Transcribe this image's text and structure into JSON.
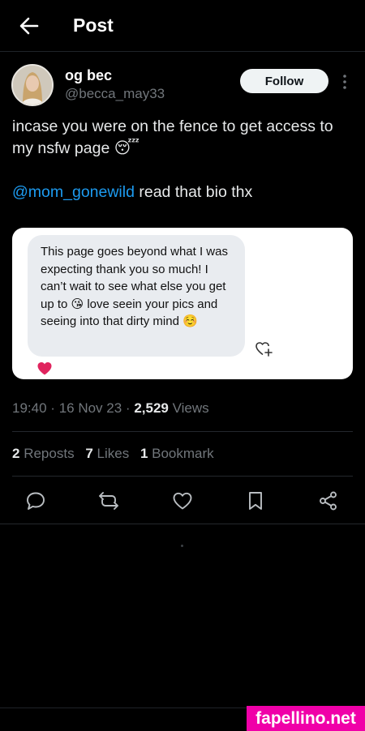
{
  "header": {
    "title": "Post"
  },
  "author": {
    "display_name": "og bec",
    "handle": "@becca_may33",
    "follow_label": "Follow"
  },
  "tweet": {
    "line1": "incase you were on the fence to get access to my nsfw page 😴",
    "mention": "@mom_gonewild",
    "line2_rest": " read that bio thx"
  },
  "media": {
    "message_text": "This page goes beyond what I was expecting thank you so much! I can’t wait to see what else you get up to 😘 love seein your pics and seeing into that dirty mind ☺️",
    "reaction_icon": "heart",
    "reaction_color": "#e0245e"
  },
  "meta": {
    "time": "19:40",
    "separator": "·",
    "date": "16 Nov 23",
    "views_count": "2,529",
    "views_label": "Views"
  },
  "stats": {
    "reposts_count": "2",
    "reposts_label": "Reposts",
    "likes_count": "7",
    "likes_label": "Likes",
    "bookmarks_count": "1",
    "bookmarks_label": "Bookmark"
  },
  "actions": [
    "reply-icon",
    "repost-icon",
    "like-icon",
    "bookmark-icon",
    "share-icon"
  ],
  "watermark": {
    "text": "fapellino.net"
  },
  "colors": {
    "background": "#000000",
    "text": "#e7e9ea",
    "muted": "#71767b",
    "link": "#1d9bf0",
    "watermark_bg": "#f000a8"
  }
}
